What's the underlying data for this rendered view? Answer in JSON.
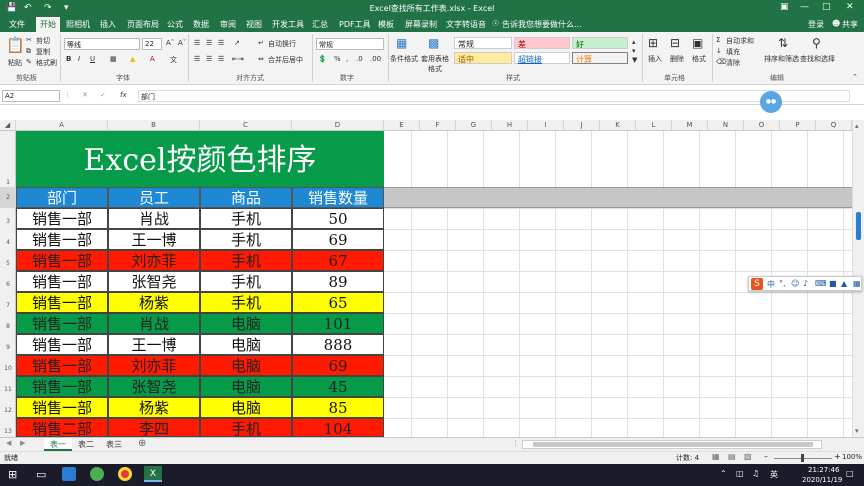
{
  "window": {
    "title": "Excel查找所有工作表.xlsx - Excel"
  },
  "tabs": [
    "文件",
    "开始",
    "照相机",
    "插入",
    "页面布局",
    "公式",
    "数据",
    "审阅",
    "视图",
    "开发工具",
    "汇总",
    "PDF工具",
    "模板",
    "屏幕录制",
    "文字转语音"
  ],
  "tell_me": "告诉我您想要做什么...",
  "account": {
    "login": "登录",
    "share": "共享"
  },
  "clipboard": {
    "paste": "粘贴",
    "cut": "剪切",
    "copy": "复制",
    "format_painter": "格式刷",
    "group": "剪贴板"
  },
  "font": {
    "name": "等线",
    "size": "22",
    "group": "字体"
  },
  "alignment": {
    "wrap": "自动换行",
    "merge": "合并后居中",
    "group": "对齐方式"
  },
  "number": {
    "format": "常规",
    "group": "数字"
  },
  "styles": {
    "conditional": "条件格式",
    "table": "套用表格格式",
    "normal": "常规",
    "bad": "差",
    "good": "好",
    "neutral": "适中",
    "hyperlink": "超链接",
    "calc": "计算",
    "group": "样式"
  },
  "cells": {
    "insert": "插入",
    "delete": "删除",
    "format": "格式",
    "group": "单元格"
  },
  "editing": {
    "autosum": "自动求和",
    "fill": "填充",
    "clear": "清除",
    "sort": "排序和筛选",
    "find": "查找和选择",
    "group": "编辑"
  },
  "formula_bar": {
    "name_box": "A2",
    "fx": "fx",
    "content": "部门"
  },
  "columns": [
    "A",
    "B",
    "C",
    "D",
    "E",
    "F",
    "G",
    "H",
    "I",
    "J",
    "K",
    "L",
    "M",
    "N",
    "O",
    "P",
    "Q"
  ],
  "rows": [
    "1",
    "2",
    "3",
    "4",
    "5",
    "6",
    "7",
    "8",
    "9",
    "10",
    "11",
    "12",
    "13"
  ],
  "banner": "Excel按颜色排序",
  "headers": [
    "部门",
    "员工",
    "商品",
    "销售数量"
  ],
  "table": [
    {
      "dept": "销售一部",
      "emp": "肖战",
      "prod": "手机",
      "qty": "50",
      "color": "white"
    },
    {
      "dept": "销售一部",
      "emp": "王一博",
      "prod": "手机",
      "qty": "69",
      "color": "white"
    },
    {
      "dept": "销售一部",
      "emp": "刘亦菲",
      "prod": "手机",
      "qty": "67",
      "color": "red"
    },
    {
      "dept": "销售一部",
      "emp": "张智尧",
      "prod": "手机",
      "qty": "89",
      "color": "white"
    },
    {
      "dept": "销售一部",
      "emp": "杨紫",
      "prod": "手机",
      "qty": "65",
      "color": "yellow"
    },
    {
      "dept": "销售一部",
      "emp": "肖战",
      "prod": "电脑",
      "qty": "101",
      "color": "green"
    },
    {
      "dept": "销售一部",
      "emp": "王一博",
      "prod": "电脑",
      "qty": "888",
      "color": "white"
    },
    {
      "dept": "销售一部",
      "emp": "刘亦菲",
      "prod": "电脑",
      "qty": "69",
      "color": "red"
    },
    {
      "dept": "销售一部",
      "emp": "张智尧",
      "prod": "电脑",
      "qty": "45",
      "color": "green"
    },
    {
      "dept": "销售一部",
      "emp": "杨紫",
      "prod": "电脑",
      "qty": "85",
      "color": "yellow"
    },
    {
      "dept": "销售二部",
      "emp": "李四",
      "prod": "手机",
      "qty": "104",
      "color": "red"
    }
  ],
  "colors": {
    "white": "#ffffff",
    "red": "#ff1a00",
    "yellow": "#ffff00",
    "green": "#069b48",
    "header_blue": "#1e88d2",
    "banner_green": "#069b48",
    "excel_green": "#217346"
  },
  "sheets": [
    "表一",
    "表二",
    "表三"
  ],
  "status": {
    "ready": "就绪",
    "count": "计数: 4",
    "zoom": "100%"
  },
  "taskbar": {
    "time": "21:27:46",
    "date": "2020/11/19"
  }
}
